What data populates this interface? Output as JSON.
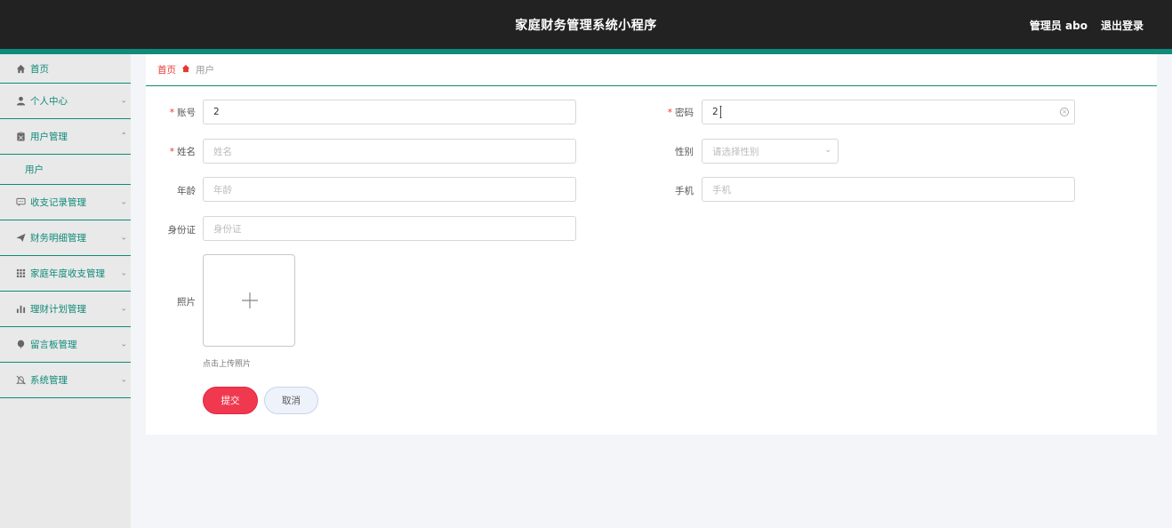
{
  "header": {
    "title": "家庭财务管理系统小程序",
    "admin": "管理员 abo",
    "logout": "退出登录"
  },
  "sidebar": {
    "items": [
      {
        "label": "首页",
        "icon": "home-icon"
      },
      {
        "label": "个人中心",
        "icon": "user-icon"
      },
      {
        "label": "用户管理",
        "icon": "users-icon"
      },
      {
        "label": "用户",
        "sub": true
      },
      {
        "label": "收支记录管理",
        "icon": "chat-icon"
      },
      {
        "label": "财务明细管理",
        "icon": "send-icon"
      },
      {
        "label": "家庭年度收支管理",
        "icon": "grid-icon"
      },
      {
        "label": "理财计划管理",
        "icon": "bar-chart-icon"
      },
      {
        "label": "留言板管理",
        "icon": "balloon-icon"
      },
      {
        "label": "系统管理",
        "icon": "bell-off-icon"
      }
    ]
  },
  "breadcrumb": {
    "home": "首页",
    "current": "用户"
  },
  "form": {
    "account": {
      "label": "账号",
      "value": "2"
    },
    "password": {
      "label": "密码",
      "value": "2"
    },
    "name": {
      "label": "姓名",
      "placeholder": "姓名"
    },
    "gender": {
      "label": "性别",
      "placeholder": "请选择性别"
    },
    "age": {
      "label": "年龄",
      "placeholder": "年龄"
    },
    "phone": {
      "label": "手机",
      "placeholder": "手机"
    },
    "idcard": {
      "label": "身份证",
      "placeholder": "身份证"
    },
    "photo": {
      "label": "照片",
      "hint": "点击上传照片"
    },
    "submit": "提交",
    "cancel": "取消"
  },
  "colors": {
    "accent": "#108a7a",
    "danger": "#f0394f",
    "topbar": "#222222"
  }
}
